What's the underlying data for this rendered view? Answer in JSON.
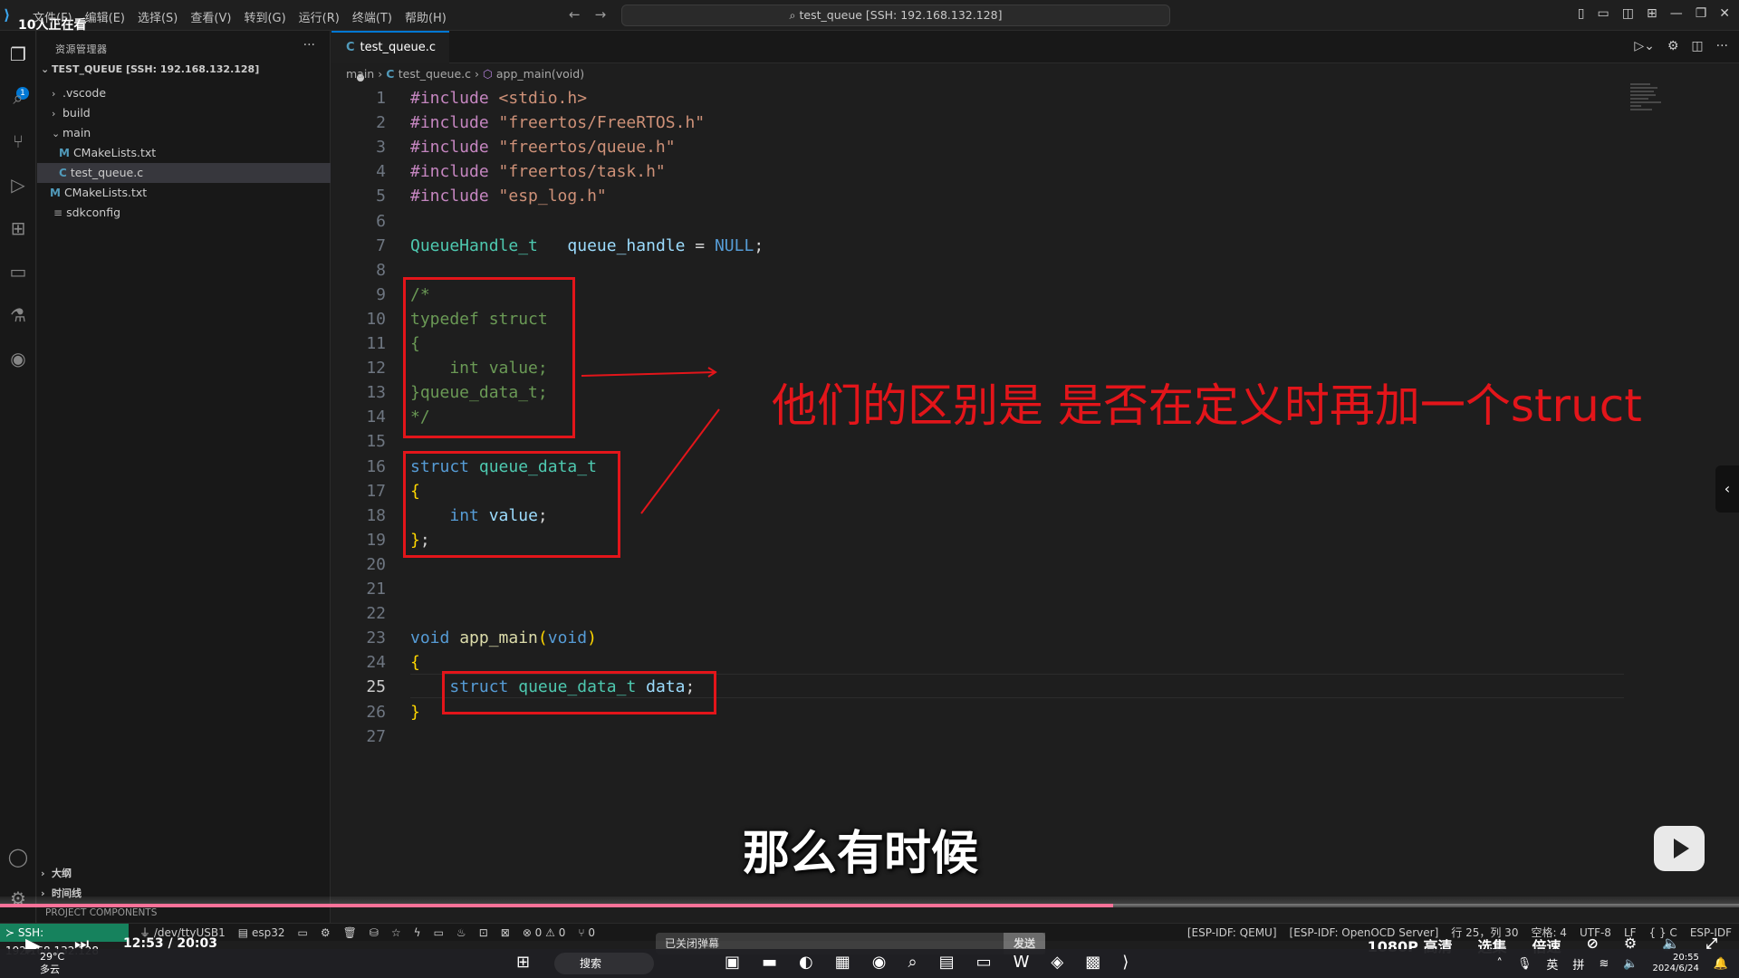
{
  "title_bar": {
    "live_viewers": "10人正在看",
    "menus": [
      "文件(F)",
      "编辑(E)",
      "选择(S)",
      "查看(V)",
      "转到(G)",
      "运行(R)",
      "终端(T)",
      "帮助(H)"
    ],
    "command_center": "test_queue [SSH: 192.168.132.128]"
  },
  "sidebar": {
    "title": "资源管理器",
    "folder": "TEST_QUEUE [SSH: 192.168.132.128]",
    "tree": [
      {
        "label": ".vscode",
        "kind": "folder",
        "indent": 1,
        "state": "collapsed"
      },
      {
        "label": "build",
        "kind": "folder",
        "indent": 1,
        "state": "collapsed"
      },
      {
        "label": "main",
        "kind": "folder",
        "indent": 1,
        "state": "expanded"
      },
      {
        "label": "CMakeLists.txt",
        "kind": "cmake",
        "indent": 2
      },
      {
        "label": "test_queue.c",
        "kind": "c",
        "indent": 2,
        "selected": true
      },
      {
        "label": "CMakeLists.txt",
        "kind": "cmake",
        "indent": 1
      },
      {
        "label": "sdkconfig",
        "kind": "config",
        "indent": 1
      }
    ],
    "outline": "大纲",
    "timeline": "时间线",
    "project_components": "PROJECT COMPONENTS"
  },
  "editor": {
    "tab_label": "test_queue.c",
    "breadcrumb": [
      "main",
      "test_queue.c",
      "app_main(void)"
    ],
    "current_line": 25
  },
  "code_lines": [
    [
      {
        "t": "#include",
        "c": "pp"
      },
      {
        "t": " <stdio.h>",
        "c": "str"
      }
    ],
    [
      {
        "t": "#include",
        "c": "pp"
      },
      {
        "t": " \"freertos/FreeRTOS.h\"",
        "c": "str"
      }
    ],
    [
      {
        "t": "#include",
        "c": "pp"
      },
      {
        "t": " \"freertos/queue.h\"",
        "c": "str"
      }
    ],
    [
      {
        "t": "#include",
        "c": "pp"
      },
      {
        "t": " \"freertos/task.h\"",
        "c": "str"
      }
    ],
    [
      {
        "t": "#include",
        "c": "pp"
      },
      {
        "t": " \"esp_log.h\"",
        "c": "str"
      }
    ],
    [],
    [
      {
        "t": "QueueHandle_t",
        "c": "ty"
      },
      {
        "t": "   ",
        "c": "pl"
      },
      {
        "t": "queue_handle",
        "c": "var"
      },
      {
        "t": " = ",
        "c": "pl"
      },
      {
        "t": "NULL",
        "c": "kw"
      },
      {
        "t": ";",
        "c": "pl"
      }
    ],
    [],
    [
      {
        "t": "/*",
        "c": "cmt"
      }
    ],
    [
      {
        "t": "typedef struct",
        "c": "cmt"
      }
    ],
    [
      {
        "t": "{",
        "c": "cmt"
      }
    ],
    [
      {
        "t": "    int value;",
        "c": "cmt"
      }
    ],
    [
      {
        "t": "}queue_data_t;",
        "c": "cmt"
      }
    ],
    [
      {
        "t": "*/",
        "c": "cmt"
      }
    ],
    [],
    [
      {
        "t": "struct",
        "c": "kw"
      },
      {
        "t": " ",
        "c": "pl"
      },
      {
        "t": "queue_data_t",
        "c": "ty"
      }
    ],
    [
      {
        "t": "{",
        "c": "br"
      }
    ],
    [
      {
        "t": "    ",
        "c": "pl"
      },
      {
        "t": "int",
        "c": "kw"
      },
      {
        "t": " ",
        "c": "pl"
      },
      {
        "t": "value",
        "c": "var"
      },
      {
        "t": ";",
        "c": "pl"
      }
    ],
    [
      {
        "t": "}",
        "c": "br"
      },
      {
        "t": ";",
        "c": "pl"
      }
    ],
    [],
    [],
    [],
    [
      {
        "t": "void",
        "c": "kw"
      },
      {
        "t": " ",
        "c": "pl"
      },
      {
        "t": "app_main",
        "c": "fn"
      },
      {
        "t": "(",
        "c": "br"
      },
      {
        "t": "void",
        "c": "kw"
      },
      {
        "t": ")",
        "c": "br"
      }
    ],
    [
      {
        "t": "{",
        "c": "br"
      }
    ],
    [
      {
        "t": "    ",
        "c": "pl"
      },
      {
        "t": "struct",
        "c": "kw"
      },
      {
        "t": " ",
        "c": "pl"
      },
      {
        "t": "queue_data_t",
        "c": "ty"
      },
      {
        "t": " ",
        "c": "pl"
      },
      {
        "t": "data",
        "c": "var"
      },
      {
        "t": ";",
        "c": "pl"
      }
    ],
    [
      {
        "t": "}",
        "c": "br"
      }
    ],
    []
  ],
  "annotation": {
    "text": "他们的区别是 是否在定义时再加一个struct",
    "color": "#e3151a"
  },
  "subtitle": "那么有时候",
  "statusbar": {
    "remote": "SSH: 192.168.132.128",
    "port": "/dev/ttyUSB1",
    "target": "esp32",
    "problems": "⊗ 0 ⚠ 0",
    "ports": "⑂ 0",
    "right": [
      "[ESP-IDF: QEMU]",
      "[ESP-IDF: OpenOCD Server]",
      "行 25，列 30",
      "空格: 4",
      "UTF-8",
      "LF",
      "{ } C",
      "ESP-IDF"
    ]
  },
  "video": {
    "time": "12:53 / 20:03",
    "progress_fraction": 0.64,
    "danmaku_placeholder": "已关闭弹幕",
    "send": "发送",
    "quality": "1080P 高清",
    "episodes": "选集",
    "speed": "倍速"
  },
  "taskbar": {
    "temperature": "29°C",
    "weather": "多云",
    "search": "搜索",
    "ime_lang": "英",
    "ime_mode": "拼",
    "clock": "20:55",
    "date": "2024/6/24"
  }
}
